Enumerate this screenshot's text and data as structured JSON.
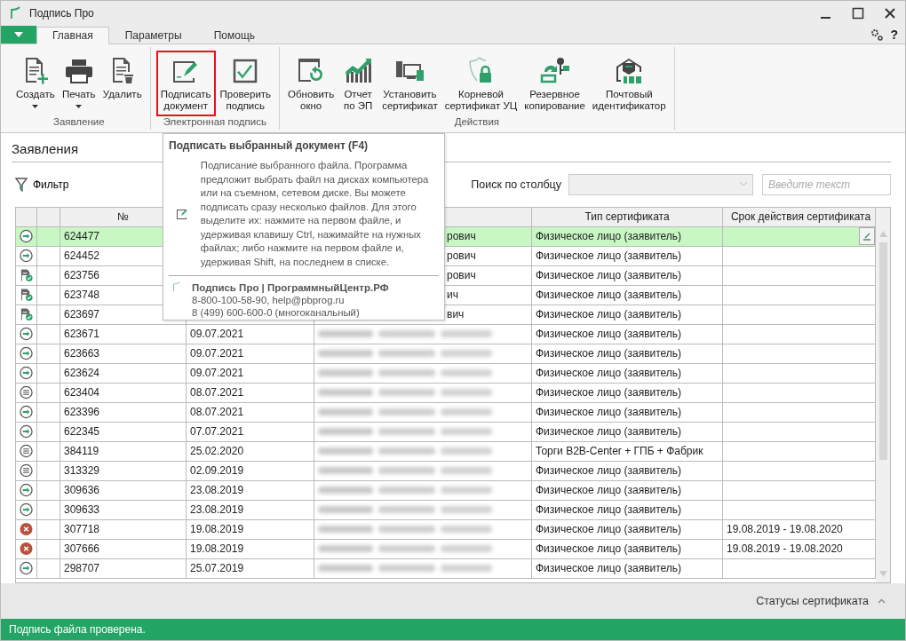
{
  "window": {
    "title": "Подпись Про",
    "help": "?"
  },
  "tabs": [
    {
      "label": "Главная",
      "selected": true
    },
    {
      "label": "Параметры",
      "selected": false
    },
    {
      "label": "Помощь",
      "selected": false
    }
  ],
  "ribbon": {
    "groups": [
      {
        "label": "Заявление",
        "buttons": [
          {
            "label": "Создать",
            "dropdown": true,
            "highlighted": false
          },
          {
            "label": "Печать",
            "dropdown": true,
            "highlighted": false
          },
          {
            "label": "Удалить",
            "dropdown": false,
            "highlighted": false
          }
        ]
      },
      {
        "label": "Электронная подпись",
        "buttons": [
          {
            "label": "Подписать документ",
            "dropdown": false,
            "highlighted": true
          },
          {
            "label": "Проверить подпись",
            "dropdown": false,
            "highlighted": false
          }
        ]
      },
      {
        "label": "Действия",
        "buttons": [
          {
            "label": "Обновить окно",
            "dropdown": false,
            "highlighted": false
          },
          {
            "label": "Отчет по ЭП",
            "dropdown": false,
            "highlighted": false
          },
          {
            "label": "Установить сертификат",
            "dropdown": false,
            "highlighted": false
          },
          {
            "label": "Корневой сертификат УЦ",
            "dropdown": false,
            "highlighted": false
          },
          {
            "label": "Резервное копирование",
            "dropdown": false,
            "highlighted": false
          },
          {
            "label": "Почтовый идентификатор",
            "dropdown": false,
            "highlighted": false
          }
        ]
      }
    ]
  },
  "section": {
    "title": "Заявления"
  },
  "filter": {
    "label": "Фильтр"
  },
  "search": {
    "label": "Поиск по столбцу",
    "placeholder": "Введите текст"
  },
  "table": {
    "columns": [
      "№",
      "Тип сертификата",
      "Срок действия сертификата"
    ],
    "rows": [
      {
        "kind": "sent",
        "selected": true,
        "number": "624477",
        "name": "рович",
        "cert_type": "Физическое лицо (заявитель)"
      },
      {
        "kind": "sent",
        "selected": false,
        "number": "624452",
        "name": "рович",
        "cert_type": "Физическое лицо (заявитель)"
      },
      {
        "kind": "signed",
        "selected": false,
        "number": "623756",
        "name": "рович",
        "cert_type": "Физическое лицо (заявитель)"
      },
      {
        "kind": "signed",
        "selected": false,
        "number": "623748",
        "name": "ич",
        "cert_type": "Физическое лицо (заявитель)"
      },
      {
        "kind": "signed",
        "selected": false,
        "number": "623697",
        "name": "вич",
        "cert_type": "Физическое лицо (заявитель)"
      },
      {
        "kind": "sent",
        "selected": false,
        "number": "623671",
        "date": "09.07.2021",
        "cert_type": "Физическое лицо (заявитель)"
      },
      {
        "kind": "sent",
        "selected": false,
        "number": "623663",
        "date": "09.07.2021",
        "cert_type": "Физическое лицо (заявитель)"
      },
      {
        "kind": "sent",
        "selected": false,
        "number": "623624",
        "date": "09.07.2021",
        "cert_type": "Физическое лицо (заявитель)"
      },
      {
        "kind": "draft",
        "selected": false,
        "number": "623404",
        "date": "08.07.2021",
        "cert_type": "Физическое лицо (заявитель)"
      },
      {
        "kind": "sent",
        "selected": false,
        "number": "623396",
        "date": "08.07.2021",
        "cert_type": "Физическое лицо (заявитель)"
      },
      {
        "kind": "sent",
        "selected": false,
        "number": "622345",
        "date": "07.07.2021",
        "cert_type": "Физическое лицо (заявитель)"
      },
      {
        "kind": "draft",
        "selected": false,
        "number": "384119",
        "date": "25.02.2020",
        "cert_type": "Торги B2B-Center + ГПБ + Фабрик"
      },
      {
        "kind": "draft",
        "selected": false,
        "number": "313329",
        "date": "02.09.2019",
        "cert_type": "Физическое лицо (заявитель)"
      },
      {
        "kind": "sent",
        "selected": false,
        "number": "309636",
        "date": "23.08.2019",
        "cert_type": "Физическое лицо (заявитель)"
      },
      {
        "kind": "sent",
        "selected": false,
        "number": "309633",
        "date": "23.08.2019",
        "cert_type": "Физическое лицо (заявитель)"
      },
      {
        "kind": "rejected",
        "selected": false,
        "number": "307718",
        "date": "19.08.2019",
        "cert_type": "Физическое лицо (заявитель)",
        "validity": "19.08.2019 - 19.08.2020"
      },
      {
        "kind": "rejected",
        "selected": false,
        "number": "307666",
        "date": "19.08.2019",
        "cert_type": "Физическое лицо (заявитель)",
        "validity": "19.08.2019 - 19.08.2020"
      },
      {
        "kind": "sent",
        "selected": false,
        "number": "298707",
        "date": "25.07.2019",
        "cert_type": "Физическое лицо (заявитель)"
      }
    ]
  },
  "tooltip": {
    "title": "Подписать выбранный документ (F4)",
    "text": "Подписание выбранного файла. Программа предложит выбрать файл на дисках компьютера или на съемном, сетевом диске. Вы можете подписать сразу несколько файлов. Для этого выделите их: нажмите на первом файле, и удерживая клавишу Ctrl, нажимайте на нужных файлах; либо нажмите на первом файле и, удерживая Shift, на последнем в списке.",
    "footer_title": "Подпись Про | ПрограммныйЦентр.РФ",
    "footer_lines": [
      "8-800-100-58-90, help@pbprog.ru",
      "8 (499) 600-600-0 (многоканальный)"
    ]
  },
  "bottom_panel": {
    "label": "Статусы сертификата"
  },
  "status_bar": {
    "text": "Подпись файла проверена."
  }
}
